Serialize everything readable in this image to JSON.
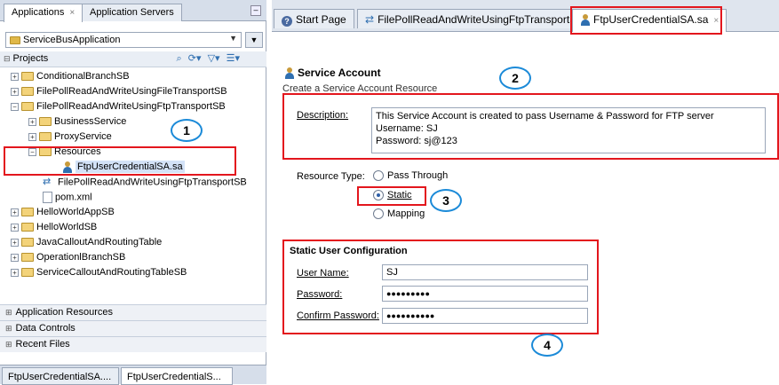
{
  "left_panel": {
    "tabs": [
      {
        "label": "Applications"
      },
      {
        "label": "Application Servers"
      }
    ],
    "application_selector": "ServiceBusApplication",
    "projects_label": "Projects",
    "tree": [
      {
        "label": "ConditionalBranchSB"
      },
      {
        "label": "FilePollReadAndWriteUsingFileTransportSB"
      },
      {
        "label": "FilePollReadAndWriteUsingFtpTransportSB"
      },
      {
        "label": "BusinessService"
      },
      {
        "label": "ProxyService"
      },
      {
        "label": "Resources"
      },
      {
        "label": "FtpUserCredentialSA.sa"
      },
      {
        "label": "FilePollReadAndWriteUsingFtpTransportSB"
      },
      {
        "label": "pom.xml"
      },
      {
        "label": "HelloWorldAppSB"
      },
      {
        "label": "HelloWorldSB"
      },
      {
        "label": "JavaCalloutAndRoutingTable"
      },
      {
        "label": "OperationlBranchSB"
      },
      {
        "label": "ServiceCalloutAndRoutingTableSB"
      }
    ],
    "accordions": [
      {
        "label": "Application Resources"
      },
      {
        "label": "Data Controls"
      },
      {
        "label": "Recent Files"
      }
    ],
    "bottom_tabs": [
      {
        "label": "FtpUserCredentialSA...."
      },
      {
        "label": "FtpUserCredentialS..."
      }
    ]
  },
  "editor_tabs": [
    {
      "label": "Start Page",
      "icon": "help-icon"
    },
    {
      "label": "FilePollReadAndWriteUsingFtpTransportSB",
      "icon": "pipeline-icon"
    },
    {
      "label": "FtpUserCredentialSA.sa",
      "icon": "service-account-icon"
    }
  ],
  "service_account": {
    "title": "Service Account",
    "subtitle": "Create a Service Account Resource",
    "description_label": "Description:",
    "description_lines": [
      "This Service Account is created to pass Username & Password for FTP server",
      "Username: SJ",
      "Password: sj@123"
    ],
    "resource_type_label": "Resource Type:",
    "resource_types": [
      {
        "label": "Pass Through",
        "selected": false
      },
      {
        "label": "Static",
        "selected": true
      },
      {
        "label": "Mapping",
        "selected": false
      }
    ],
    "static_config": {
      "title": "Static User Configuration",
      "user_name_label": "User Name:",
      "user_name_value": "SJ",
      "password_label": "Password:",
      "password_value": "●●●●●●●●●",
      "confirm_label": "Confirm Password:",
      "confirm_value": "●●●●●●●●●●"
    }
  },
  "annotations": {
    "bubble_1": "1",
    "bubble_2": "2",
    "bubble_3": "3",
    "bubble_4": "4"
  },
  "colors": {
    "highlight_border": "#e3161d",
    "bubble_border": "#1b8ad8",
    "folder": "#f3d37a"
  }
}
